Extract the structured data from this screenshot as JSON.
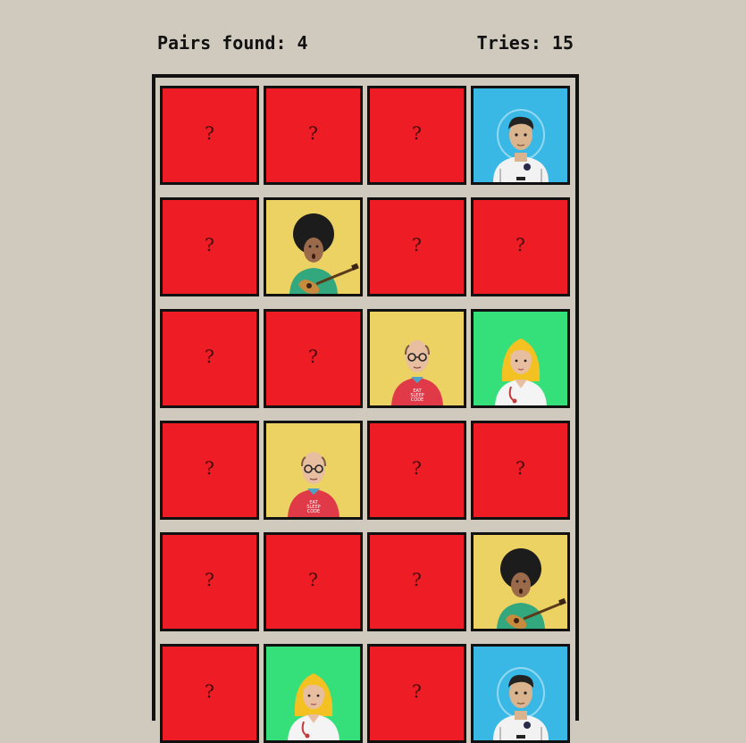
{
  "stats": {
    "pairs_label": "Pairs found: 4",
    "tries_label": "Tries: 15"
  },
  "hidden_symbol": "?",
  "colors": {
    "card_back": "#ee1c25",
    "astronaut_bg": "#3ab8e5",
    "guitarist_bg": "#ecd263",
    "scientist_bg": "#ecd263",
    "doctor_bg": "#35e07a"
  },
  "cards": [
    {
      "state": "hidden"
    },
    {
      "state": "hidden"
    },
    {
      "state": "hidden"
    },
    {
      "state": "revealed",
      "character": "astronaut"
    },
    {
      "state": "hidden"
    },
    {
      "state": "revealed",
      "character": "guitarist"
    },
    {
      "state": "hidden"
    },
    {
      "state": "hidden"
    },
    {
      "state": "hidden"
    },
    {
      "state": "hidden"
    },
    {
      "state": "revealed",
      "character": "scientist"
    },
    {
      "state": "revealed",
      "character": "doctor"
    },
    {
      "state": "hidden"
    },
    {
      "state": "revealed",
      "character": "scientist"
    },
    {
      "state": "hidden"
    },
    {
      "state": "hidden"
    },
    {
      "state": "hidden"
    },
    {
      "state": "hidden"
    },
    {
      "state": "hidden"
    },
    {
      "state": "revealed",
      "character": "guitarist"
    },
    {
      "state": "hidden"
    },
    {
      "state": "revealed",
      "character": "doctor"
    },
    {
      "state": "hidden"
    },
    {
      "state": "revealed",
      "character": "astronaut"
    }
  ]
}
